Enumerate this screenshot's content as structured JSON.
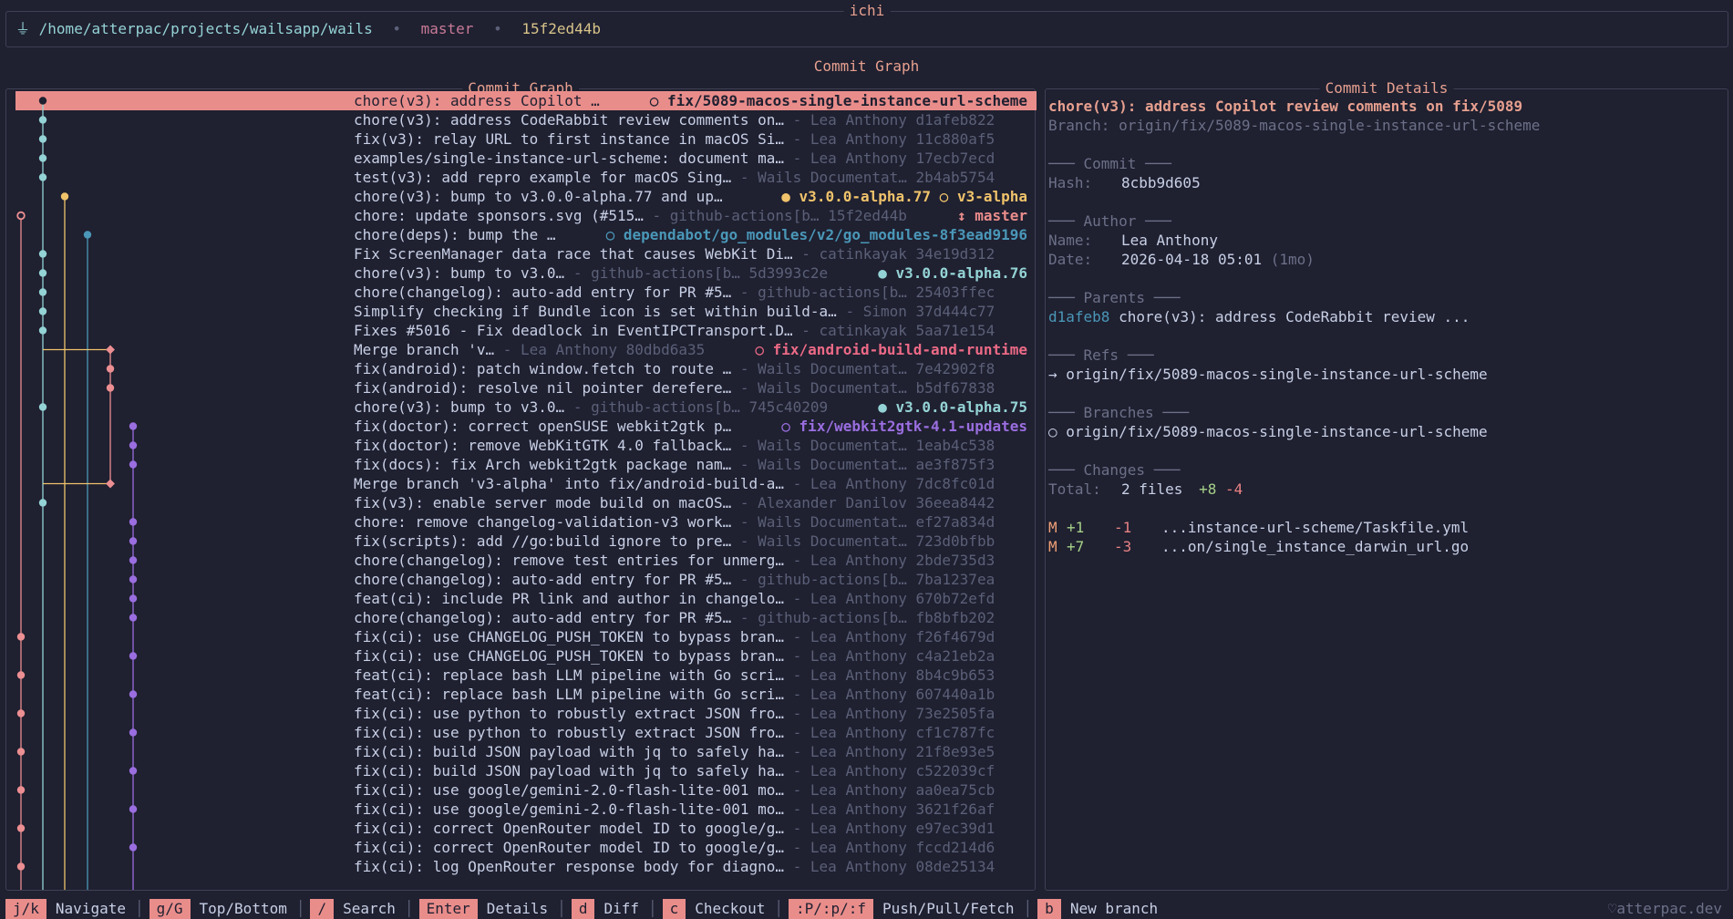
{
  "app": {
    "title": "ichi"
  },
  "topbar": {
    "plug_icon": "plug-icon",
    "path": "/home/atterpac/projects/wailsapp/wails",
    "sep": "•",
    "branch": "master",
    "head_hash": "15f2ed44b"
  },
  "main": {
    "title": "Commit Graph"
  },
  "graph": {
    "title": "Commit Graph",
    "commits": [
      {
        "lane": 1,
        "node": "dark",
        "msg": "chore(v3): address Copilot …",
        "meta": "",
        "ref": "○ fix/5089-macos-single-instance-url-scheme",
        "ref_color": "#1f2030",
        "selected": true
      },
      {
        "lane": 1,
        "node": "teal",
        "msg": "chore(v3): address CodeRabbit review comments on…",
        "meta": " - Lea Anthony d1afeb822",
        "ref": "",
        "ref_color": ""
      },
      {
        "lane": 1,
        "node": "teal",
        "msg": "fix(v3): relay URL to first instance in macOS Si…",
        "meta": " - Lea Anthony 11c880af5",
        "ref": "",
        "ref_color": ""
      },
      {
        "lane": 1,
        "node": "teal",
        "msg": "examples/single-instance-url-scheme: document ma…",
        "meta": " - Lea Anthony 17ecb7ecd",
        "ref": "",
        "ref_color": ""
      },
      {
        "lane": 1,
        "node": "teal",
        "msg": "test(v3): add repro example for macOS Sing…",
        "meta": " - Wails Documentat… 2b4ab5754",
        "ref": "",
        "ref_color": ""
      },
      {
        "lane": 2,
        "node": "yellow",
        "msg": "chore(v3): bump to v3.0.0-alpha.77 and up…",
        "meta": "",
        "ref": "● v3.0.0-alpha.77  ○ v3-alpha",
        "ref_color": "#f0c36b"
      },
      {
        "lane": 0,
        "node": "pinkring",
        "msg": "chore: update sponsors.svg (#515…",
        "meta": " - github-actions[b… 15f2ed44b",
        "ref": "↕ master",
        "ref_color": "#e98d8b"
      },
      {
        "lane": 3,
        "node": "blue",
        "msg": "chore(deps): bump the …",
        "meta": "",
        "ref": "○ dependabot/go_modules/v2/go_modules-8f3ead9196",
        "ref_color": "#4a97b8"
      },
      {
        "lane": 1,
        "node": "teal",
        "msg": "Fix ScreenManager data race that causes WebKit Di…",
        "meta": " - catinkayak 34e19d312",
        "ref": "",
        "ref_color": ""
      },
      {
        "lane": 1,
        "node": "teal",
        "msg": "chore(v3): bump to v3.0…",
        "meta": " - github-actions[b… 5d3993c2e",
        "ref": "● v3.0.0-alpha.76",
        "ref_color": "#94d3d5"
      },
      {
        "lane": 1,
        "node": "teal",
        "msg": "chore(changelog): auto-add entry for PR #5…",
        "meta": " - github-actions[b… 25403ffec",
        "ref": "",
        "ref_color": ""
      },
      {
        "lane": 1,
        "node": "teal",
        "msg": "Simplify checking if Bundle icon is set within build-a…",
        "meta": " - Simon 37d444c77",
        "ref": "",
        "ref_color": ""
      },
      {
        "lane": 1,
        "node": "teal",
        "msg": "Fixes #5016 - Fix deadlock in EventIPCTransport.D…",
        "meta": " - catinkayak 5aa71e154",
        "ref": "",
        "ref_color": ""
      },
      {
        "lane": 4,
        "node": "diamond",
        "msg": "Merge branch 'v…",
        "meta": " - Lea Anthony 80dbd6a35",
        "ref": "○ fix/android-build-and-runtime",
        "ref_color": "#ec6a86",
        "merge_from": 1
      },
      {
        "lane": 4,
        "node": "pink",
        "msg": "fix(android): patch window.fetch to route …",
        "meta": " - Wails Documentat… 7e42902f8",
        "ref": "",
        "ref_color": ""
      },
      {
        "lane": 4,
        "node": "pink",
        "msg": "fix(android): resolve nil pointer derefere…",
        "meta": " - Wails Documentat… b5df67838",
        "ref": "",
        "ref_color": ""
      },
      {
        "lane": 1,
        "node": "teal",
        "msg": "chore(v3): bump to v3.0…",
        "meta": " - github-actions[b… 745c40209",
        "ref": "● v3.0.0-alpha.75",
        "ref_color": "#94d3d5"
      },
      {
        "lane": 5,
        "node": "purple",
        "msg": "fix(doctor): correct openSUSE webkit2gtk p…",
        "meta": "",
        "ref": "○ fix/webkit2gtk-4.1-updates",
        "ref_color": "#9a6ee0"
      },
      {
        "lane": 5,
        "node": "purple",
        "msg": "fix(doctor): remove WebKitGTK 4.0 fallback…",
        "meta": " - Wails Documentat… 1eab4c538",
        "ref": "",
        "ref_color": ""
      },
      {
        "lane": 5,
        "node": "purple",
        "msg": "fix(docs): fix Arch webkit2gtk package nam…",
        "meta": " - Wails Documentat… ae3f875f3",
        "ref": "",
        "ref_color": ""
      },
      {
        "lane": 4,
        "node": "diamond",
        "msg": "Merge branch 'v3-alpha' into fix/android-build-a…",
        "meta": " - Lea Anthony 7dc8fc01d",
        "ref": "",
        "ref_color": "",
        "merge_from": 1
      },
      {
        "lane": 1,
        "node": "teal",
        "msg": "fix(v3): enable server mode build on macOS…",
        "meta": " - Alexander Danilov 36eea8442",
        "ref": "",
        "ref_color": ""
      },
      {
        "lane": 5,
        "node": "purple",
        "msg": "chore: remove changelog-validation-v3 work…",
        "meta": " - Wails Documentat… ef27a834d",
        "ref": "",
        "ref_color": ""
      },
      {
        "lane": 5,
        "node": "purple",
        "msg": "fix(scripts): add //go:build ignore to pre…",
        "meta": " - Wails Documentat… 723d0bfbb",
        "ref": "",
        "ref_color": ""
      },
      {
        "lane": 5,
        "node": "purple",
        "msg": "chore(changelog): remove test entries for unmerg…",
        "meta": " - Lea Anthony 2bde735d3",
        "ref": "",
        "ref_color": ""
      },
      {
        "lane": 5,
        "node": "purple",
        "msg": "chore(changelog): auto-add entry for PR #5…",
        "meta": " - github-actions[b… 7ba1237ea",
        "ref": "",
        "ref_color": ""
      },
      {
        "lane": 5,
        "node": "purple",
        "msg": "feat(ci): include PR link and author in changelo…",
        "meta": " - Lea Anthony 670b72efd",
        "ref": "",
        "ref_color": ""
      },
      {
        "lane": 5,
        "node": "purple",
        "msg": "chore(changelog): auto-add entry for PR #5…",
        "meta": " - github-actions[b… fb8bfb202",
        "ref": "",
        "ref_color": ""
      },
      {
        "lane": 0,
        "node": "pink",
        "msg": "fix(ci): use CHANGELOG_PUSH_TOKEN to bypass bran…",
        "meta": " - Lea Anthony f26f4679d",
        "ref": "",
        "ref_color": ""
      },
      {
        "lane": 5,
        "node": "purple",
        "msg": "fix(ci): use CHANGELOG_PUSH_TOKEN to bypass bran…",
        "meta": " - Lea Anthony c4a21eb2a",
        "ref": "",
        "ref_color": ""
      },
      {
        "lane": 0,
        "node": "pink",
        "msg": "feat(ci): replace bash LLM pipeline with Go scri…",
        "meta": " - Lea Anthony 8b4c9b653",
        "ref": "",
        "ref_color": ""
      },
      {
        "lane": 5,
        "node": "purple",
        "msg": "feat(ci): replace bash LLM pipeline with Go scri…",
        "meta": " - Lea Anthony 607440a1b",
        "ref": "",
        "ref_color": ""
      },
      {
        "lane": 0,
        "node": "pink",
        "msg": "fix(ci): use python to robustly extract JSON fro…",
        "meta": " - Lea Anthony 73e2505fa",
        "ref": "",
        "ref_color": ""
      },
      {
        "lane": 5,
        "node": "purple",
        "msg": "fix(ci): use python to robustly extract JSON fro…",
        "meta": " - Lea Anthony cf1c787fc",
        "ref": "",
        "ref_color": ""
      },
      {
        "lane": 0,
        "node": "pink",
        "msg": "fix(ci): build JSON payload with jq to safely ha…",
        "meta": " - Lea Anthony 21f8e93e5",
        "ref": "",
        "ref_color": ""
      },
      {
        "lane": 5,
        "node": "purple",
        "msg": "fix(ci): build JSON payload with jq to safely ha…",
        "meta": " - Lea Anthony c522039cf",
        "ref": "",
        "ref_color": ""
      },
      {
        "lane": 0,
        "node": "pink",
        "msg": "fix(ci): use google/gemini-2.0-flash-lite-001 mo…",
        "meta": " - Lea Anthony aa0ea75cb",
        "ref": "",
        "ref_color": ""
      },
      {
        "lane": 5,
        "node": "purple",
        "msg": "fix(ci): use google/gemini-2.0-flash-lite-001 mo…",
        "meta": " - Lea Anthony 3621f26af",
        "ref": "",
        "ref_color": ""
      },
      {
        "lane": 0,
        "node": "pink",
        "msg": "fix(ci): correct OpenRouter model ID to google/g…",
        "meta": " - Lea Anthony e97ec39d1",
        "ref": "",
        "ref_color": ""
      },
      {
        "lane": 5,
        "node": "purple",
        "msg": "fix(ci): correct OpenRouter model ID to google/g…",
        "meta": " - Lea Anthony fccd214d6",
        "ref": "",
        "ref_color": ""
      },
      {
        "lane": 0,
        "node": "pink",
        "msg": "fix(ci): log OpenRouter response body for diagno…",
        "meta": " - Lea Anthony 08de25134",
        "ref": "",
        "ref_color": ""
      }
    ]
  },
  "details": {
    "title": "Commit Details",
    "subject": "chore(v3): address Copilot review comments on fix/5089",
    "branch_line": "Branch: origin/fix/5089-macos-single-instance-url-scheme",
    "commit_section": "─── Commit ───",
    "hash_label": "Hash:",
    "hash": "8cbb9d605",
    "author_section": "─── Author ───",
    "name_label": "Name:",
    "name": "Lea Anthony",
    "date_label": "Date:",
    "date": "2026-04-18 05:01",
    "date_rel": "(1mo)",
    "parents_section": "─── Parents ───",
    "parent_hash": "d1afeb8",
    "parent_msg": "chore(v3): address CodeRabbit review  ...",
    "refs_section": "─── Refs ───",
    "ref_line": "→ origin/fix/5089-macos-single-instance-url-scheme",
    "branches_section": "─── Branches ───",
    "branch_entry": "○ origin/fix/5089-macos-single-instance-url-scheme",
    "changes_section": "─── Changes ───",
    "total_label": "Total:",
    "total_files": "2 files",
    "total_add": "+8",
    "total_del": "-4",
    "files": [
      {
        "status": "M",
        "add": "+1",
        "del": "-1",
        "path": "...instance-url-scheme/Taskfile.yml"
      },
      {
        "status": "M",
        "add": "+7",
        "del": "-3",
        "path": "...on/single_instance_darwin_url.go"
      }
    ]
  },
  "footer": {
    "keys": [
      {
        "key": "j/k",
        "desc": "Navigate"
      },
      {
        "key": "g/G",
        "desc": "Top/Bottom"
      },
      {
        "key": "/",
        "desc": "Search"
      },
      {
        "key": "Enter",
        "desc": "Details"
      },
      {
        "key": "d",
        "desc": "Diff"
      },
      {
        "key": "c",
        "desc": "Checkout"
      },
      {
        "key": ":P/:p/:f",
        "desc": "Push/Pull/Fetch"
      },
      {
        "key": "b",
        "desc": "New branch"
      }
    ],
    "sep": "│",
    "heart_icon": "heart-icon",
    "credit": "atterpac.dev"
  },
  "colors": {
    "teal": "#94d3d5",
    "pink": "#ec8f92",
    "yellow": "#f0c36b",
    "blue": "#4a97b8",
    "purple": "#9a6ee0",
    "accent": "#e98d8b",
    "bg": "#1f2030"
  }
}
